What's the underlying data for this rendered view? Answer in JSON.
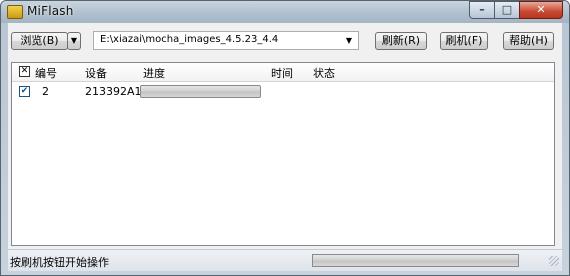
{
  "window": {
    "title": "MiFlash"
  },
  "window_controls": {
    "minimize": "–",
    "maximize": "□",
    "close": "✕"
  },
  "toolbar": {
    "browse_label": "浏览(B)",
    "browse_arrow": "▼",
    "path_value": "E:\\xiazai\\mocha_images_4.5.23_4.4",
    "path_arrow": "▼",
    "refresh_label": "刷新(R)",
    "flash_label": "刷机(F)",
    "help_label": "帮助(H)"
  },
  "grid": {
    "header_check": "✕",
    "columns": [
      "编号",
      "设备",
      "进度",
      "时间",
      "状态"
    ],
    "rows": [
      {
        "checked": "✔",
        "number": "2",
        "device": "213392A1",
        "progress": 0,
        "time": "",
        "status": ""
      }
    ]
  },
  "status": {
    "text": "按刷机按钮开始操作",
    "progress": 0
  },
  "colors": {
    "progress_fill": "#4ec03e",
    "title_bar": "#aebecc"
  }
}
